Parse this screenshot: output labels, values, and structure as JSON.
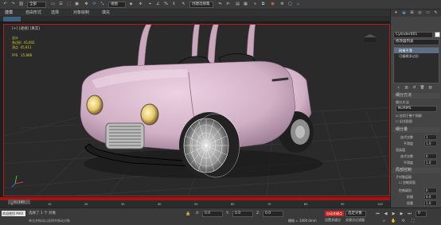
{
  "toolbar": {
    "undo_icon": "undo-icon",
    "redo_icon": "redo-icon",
    "link_icon": "link-icon",
    "select_filter": "全部",
    "view_dropdown": "视图",
    "selection_set": "创建选择集"
  },
  "ribbon_tabs": [
    "建模",
    "自由形式",
    "选择",
    "对象绘制",
    "填充"
  ],
  "subribbon_label": "多边形建模",
  "viewport": {
    "label": "[+] [透视] [真实]",
    "stats": [
      {
        "label": "总计",
        "value": ""
      },
      {
        "label": "多边形",
        "value": "43,002"
      },
      {
        "label": "顶点",
        "value": "45,911"
      },
      {
        "label": "FPS",
        "value": "15.868"
      }
    ]
  },
  "command_panel": {
    "object_name": "Cylinder001",
    "modifier_list": "修改器列表",
    "stack": [
      "网格平滑",
      "可编辑多边形"
    ],
    "sections": {
      "subdivision_method": {
        "title": "细分方法",
        "method_label": "细分方法",
        "method_value": "NURMS",
        "apply_whole": "应用于整个网格",
        "old_style": "旧式贴图"
      },
      "subdivision_amount": {
        "title": "细分量",
        "iterations_label": "迭代次数",
        "iterations_value": "1",
        "smoothness_label": "平滑度",
        "smoothness_value": "1.0",
        "render_label": "渲染值",
        "render_iterations_label": "迭代次数",
        "render_iterations_value": "0",
        "render_smoothness_label": "平滑度",
        "render_smoothness_value": "1.0"
      },
      "local_control": {
        "title": "局部控制",
        "sublevel_label": "子对象层级",
        "ignore_backfacing": "忽略背面",
        "control_level_label": "控制级别",
        "control_level_value": "0",
        "crease_label": "折缝",
        "crease_value": "0.0",
        "weight_label": "权重",
        "weight_value": "1.0",
        "isoline": "等值线显示",
        "show_cage": "显示框架"
      },
      "update": {
        "title": "重置"
      }
    }
  },
  "timeline": {
    "frame_label": "0 / 100",
    "ticks": [
      "0",
      "10",
      "20",
      "30",
      "40",
      "50",
      "60",
      "70",
      "80",
      "90",
      "100"
    ]
  },
  "status": {
    "welcome": "欢迎使用 MAX",
    "selected": "选择了 1 个 对象",
    "hint": "单击并拖动以选择并移动对象",
    "x_label": "X:",
    "x_value": "0.0",
    "y_label": "Y:",
    "y_value": "0.0",
    "z_label": "Z:",
    "z_value": "0.0",
    "grid": "栅格 = 1000.0mm",
    "auto_key": "自动关键点",
    "selected_obj": "选定对象",
    "set_key": "设置关键点",
    "key_filter": "关键点过滤器",
    "frame": "0"
  },
  "colors": {
    "accent_red": "#cc2020",
    "viewport_border": "#b71c1c",
    "timeline_bar": "#a01515",
    "car_body": "#d9b9cf"
  }
}
